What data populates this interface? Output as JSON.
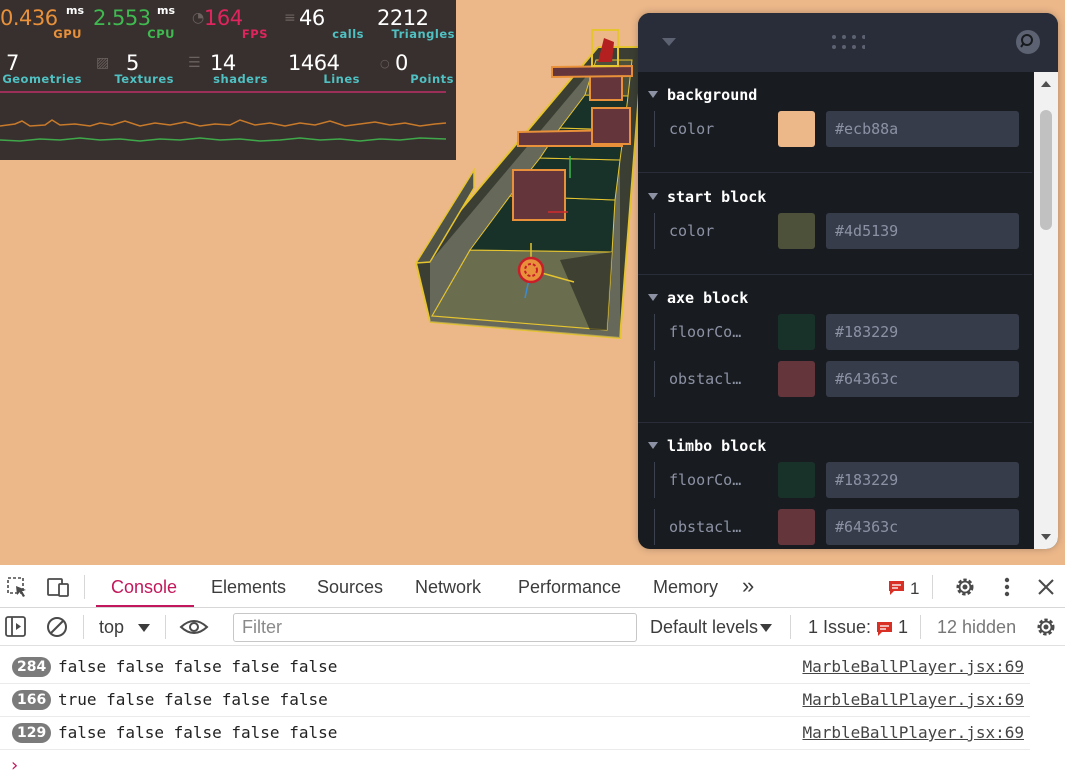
{
  "perf": {
    "gpu": {
      "value": "0.436",
      "unit": "ms",
      "label": "GPU"
    },
    "cpu": {
      "value": "2.553",
      "unit": "ms",
      "label": "CPU"
    },
    "fps": {
      "value": "164",
      "label": "FPS"
    },
    "calls": {
      "value": "46",
      "label": "calls"
    },
    "triangles": {
      "value": "2212",
      "label": "Triangles"
    },
    "geometries": {
      "value": "7",
      "label": "Geometries"
    },
    "textures": {
      "value": "5",
      "label": "Textures"
    },
    "shaders": {
      "value": "14",
      "label": "shaders"
    },
    "lines": {
      "value": "1464",
      "label": "Lines"
    },
    "points": {
      "value": "0",
      "label": "Points"
    },
    "colors": {
      "gpu": "#e8913a",
      "cpu": "#3fb950",
      "fps": "#e0245e",
      "label_teal": "#4fc1c3",
      "graph_orange": "#c87a2a",
      "graph_green": "#3fa84a",
      "separator": "#9b2f5a"
    }
  },
  "leva": {
    "folders": [
      {
        "title": "background",
        "rows": [
          {
            "label": "color",
            "value": "#ecb88a",
            "swatch": "#ecb88a"
          }
        ]
      },
      {
        "title": "start block",
        "rows": [
          {
            "label": "color",
            "value": "#4d5139",
            "swatch": "#4d5139"
          }
        ]
      },
      {
        "title": "axe block",
        "rows": [
          {
            "label": "floorCo…",
            "value": "#183229",
            "swatch": "#183229"
          },
          {
            "label": "obstacl…",
            "value": "#64363c",
            "swatch": "#64363c"
          }
        ]
      },
      {
        "title": "limbo block",
        "rows": [
          {
            "label": "floorCo…",
            "value": "#183229",
            "swatch": "#183229"
          },
          {
            "label": "obstacl…",
            "value": "#64363c",
            "swatch": "#64363c"
          }
        ]
      }
    ]
  },
  "devtools": {
    "tabs": [
      "Console",
      "Elements",
      "Sources",
      "Network",
      "Performance",
      "Memory"
    ],
    "active_tab": "Console",
    "issues_badge_count": "1",
    "toolbar": {
      "context": "top",
      "filter_placeholder": "Filter",
      "levels": "Default levels",
      "issues_label": "1 Issue:",
      "issues_count": "1",
      "hidden": "12 hidden"
    },
    "logs": [
      {
        "count": "284",
        "message": "false false false false false",
        "source": "MarbleBallPlayer.jsx:69"
      },
      {
        "count": "166",
        "message": "true false false false false",
        "source": "MarbleBallPlayer.jsx:69"
      },
      {
        "count": "129",
        "message": "false false false false false",
        "source": "MarbleBallPlayer.jsx:69"
      }
    ],
    "prompt": "›"
  }
}
